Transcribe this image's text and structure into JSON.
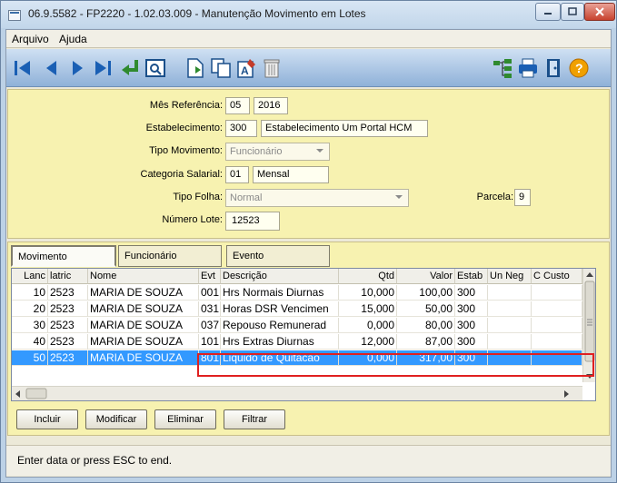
{
  "window": {
    "title": "06.9.5582 - FP2220 - 1.02.03.009 - Manutenção Movimento em Lotes"
  },
  "menu": {
    "items": [
      "Arquivo",
      "Ajuda"
    ]
  },
  "toolbar": {
    "left_icons": [
      "first-record-icon",
      "previous-record-icon",
      "next-record-icon",
      "last-record-icon",
      "return-icon",
      "zoom-icon",
      "new-record-icon",
      "copy-icon",
      "edit-icon",
      "delete-icon"
    ],
    "right_icons": [
      "tree-icon",
      "print-icon",
      "exit-icon",
      "help-icon"
    ]
  },
  "form": {
    "mes_referencia": {
      "label": "Mês Referência:",
      "month": "05",
      "year": "2016"
    },
    "estabelecimento": {
      "label": "Estabelecimento:",
      "code": "300",
      "name": "Estabelecimento Um Portal HCM"
    },
    "tipo_movimento": {
      "label": "Tipo Movimento:",
      "value": "Funcionário"
    },
    "categoria_salarial": {
      "label": "Categoria Salarial:",
      "code": "01",
      "name": "Mensal"
    },
    "tipo_folha": {
      "label": "Tipo Folha:",
      "value": "Normal"
    },
    "parcela": {
      "label": "Parcela:",
      "value": "9"
    },
    "numero_lote": {
      "label": "Número Lote:",
      "value": "12523"
    }
  },
  "tabs": [
    "Movimento",
    "Funcionário",
    "Evento"
  ],
  "grid": {
    "columns": [
      "Lanc",
      "latric",
      "Nome",
      "Evt",
      "Descrição",
      "Qtd",
      "Valor",
      "Estab",
      "Un Neg",
      "C Custo"
    ],
    "rows": [
      {
        "lanc": "10",
        "matric": "2523",
        "nome": "MARIA DE SOUZA",
        "evt": "001",
        "descricao": "Hrs Normais Diurnas",
        "qtd": "10,000",
        "valor": "100,00",
        "estab": "300"
      },
      {
        "lanc": "20",
        "matric": "2523",
        "nome": "MARIA DE SOUZA",
        "evt": "031",
        "descricao": "Horas DSR Vencimen",
        "qtd": "15,000",
        "valor": "50,00",
        "estab": "300"
      },
      {
        "lanc": "30",
        "matric": "2523",
        "nome": "MARIA DE SOUZA",
        "evt": "037",
        "descricao": "Repouso Remunerad",
        "qtd": "0,000",
        "valor": "80,00",
        "estab": "300"
      },
      {
        "lanc": "40",
        "matric": "2523",
        "nome": "MARIA DE SOUZA",
        "evt": "101",
        "descricao": "Hrs Extras Diurnas",
        "qtd": "12,000",
        "valor": "87,00",
        "estab": "300"
      },
      {
        "lanc": "50",
        "matric": "2523",
        "nome": "MARIA DE SOUZA",
        "evt": "801",
        "descricao": "Liquido de Quitacao",
        "qtd": "0,000",
        "valor": "317,00",
        "estab": "300"
      }
    ]
  },
  "buttons": {
    "incluir": "Incluir",
    "modificar": "Modificar",
    "eliminar": "Eliminar",
    "filtrar": "Filtrar"
  },
  "status": {
    "text": "Enter data or press ESC to end."
  },
  "colors": {
    "accent": "#3399ff",
    "highlight": "#e02020",
    "form_bg": "#f7f2b0"
  }
}
